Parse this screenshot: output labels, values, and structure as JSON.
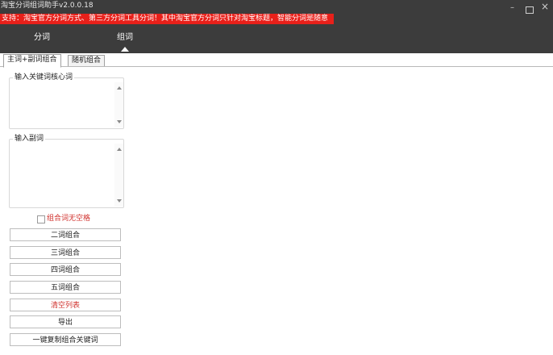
{
  "window": {
    "title": "淘宝分词组词助手v2.0.0.18"
  },
  "notice": {
    "text": "支持：淘宝官方分词方式、第三方分词工具分词！其中淘宝官方分词只针对淘宝标题，智能分词是随意"
  },
  "nav": {
    "tabs": [
      {
        "label": "分词"
      },
      {
        "label": "组词"
      }
    ]
  },
  "subtabs": [
    {
      "label": "主词+副词组合"
    },
    {
      "label": "随机组合"
    }
  ],
  "core_input": {
    "legend": "输入关键词核心词",
    "value": ""
  },
  "sub_input": {
    "legend": "输入副词",
    "value": ""
  },
  "checkbox": {
    "label": "组合词无空格",
    "checked": false
  },
  "buttons": {
    "two": "二词组合",
    "three": "三词组合",
    "four": "四词组合",
    "five": "五词组合",
    "clear": "清空列表",
    "export": "导出",
    "copy": "一键复制组合关键词"
  },
  "colors": {
    "topbar": "#3c3c3c",
    "notice_bg": "#e8201a",
    "accent_red": "#d0312d"
  }
}
